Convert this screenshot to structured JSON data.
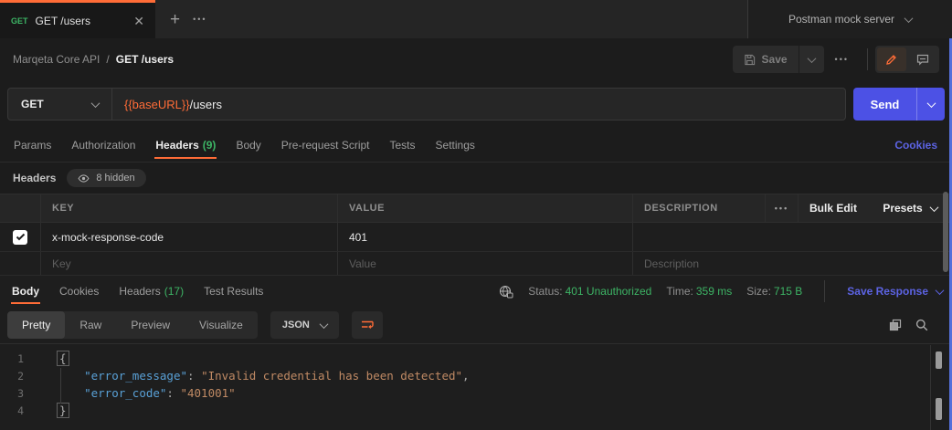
{
  "colors": {
    "accent_orange": "#ff6c37",
    "method_green": "#3db465",
    "link_blue": "#5c63e3",
    "send_blue": "#4c51e5",
    "json_key_blue": "#59a0d6",
    "json_string_orange": "#c08a64",
    "edge_accent_blue": "#5570da"
  },
  "topbar": {
    "tab_method": "GET",
    "tab_title": "GET /users",
    "more": "•••",
    "environment": "Postman mock server"
  },
  "breadcrumb": {
    "collection": "Marqeta Core API",
    "separator": "/",
    "current": "GET /users"
  },
  "header_actions": {
    "save_label": "Save",
    "more": "•••"
  },
  "request": {
    "method": "GET",
    "url_variable": "{{baseURL}}",
    "url_path": "/users",
    "send_label": "Send"
  },
  "request_tabs": {
    "items": [
      {
        "label": "Params"
      },
      {
        "label": "Authorization"
      },
      {
        "label": "Headers",
        "count": "(9)",
        "active": true
      },
      {
        "label": "Body"
      },
      {
        "label": "Pre-request Script"
      },
      {
        "label": "Tests"
      },
      {
        "label": "Settings"
      }
    ],
    "cookies_link": "Cookies"
  },
  "headers_panel": {
    "title": "Headers",
    "hidden_badge": "8 hidden",
    "columns": {
      "key": "KEY",
      "value": "VALUE",
      "description": "DESCRIPTION"
    },
    "more": "•••",
    "bulk_edit": "Bulk Edit",
    "presets": "Presets",
    "rows": [
      {
        "checked": true,
        "key": "x-mock-response-code",
        "value": "401",
        "description": ""
      }
    ],
    "placeholders": {
      "key": "Key",
      "value": "Value",
      "description": "Description"
    }
  },
  "response": {
    "tabs": [
      {
        "label": "Body",
        "active": true
      },
      {
        "label": "Cookies"
      },
      {
        "label": "Headers",
        "count": "(17)"
      },
      {
        "label": "Test Results"
      }
    ],
    "status_label": "Status:",
    "status_value": "401 Unauthorized",
    "time_label": "Time:",
    "time_value": "359 ms",
    "size_label": "Size:",
    "size_value": "715 B",
    "save_response_label": "Save Response",
    "view_tabs": [
      {
        "label": "Pretty",
        "active": true
      },
      {
        "label": "Raw"
      },
      {
        "label": "Preview"
      },
      {
        "label": "Visualize"
      }
    ],
    "format": "JSON",
    "code": {
      "lines": [
        {
          "num": "1",
          "tokens": [
            {
              "text": "{",
              "type": "brace"
            }
          ]
        },
        {
          "num": "2",
          "tokens": [
            {
              "text": "    ",
              "type": "plain"
            },
            {
              "text": "\"error_message\"",
              "type": "key"
            },
            {
              "text": ": ",
              "type": "plain"
            },
            {
              "text": "\"Invalid credential has been detected\"",
              "type": "string"
            },
            {
              "text": ",",
              "type": "plain"
            }
          ]
        },
        {
          "num": "3",
          "tokens": [
            {
              "text": "    ",
              "type": "plain"
            },
            {
              "text": "\"error_code\"",
              "type": "key"
            },
            {
              "text": ": ",
              "type": "plain"
            },
            {
              "text": "\"401001\"",
              "type": "string"
            }
          ]
        },
        {
          "num": "4",
          "tokens": [
            {
              "text": "}",
              "type": "brace"
            }
          ]
        }
      ]
    }
  }
}
